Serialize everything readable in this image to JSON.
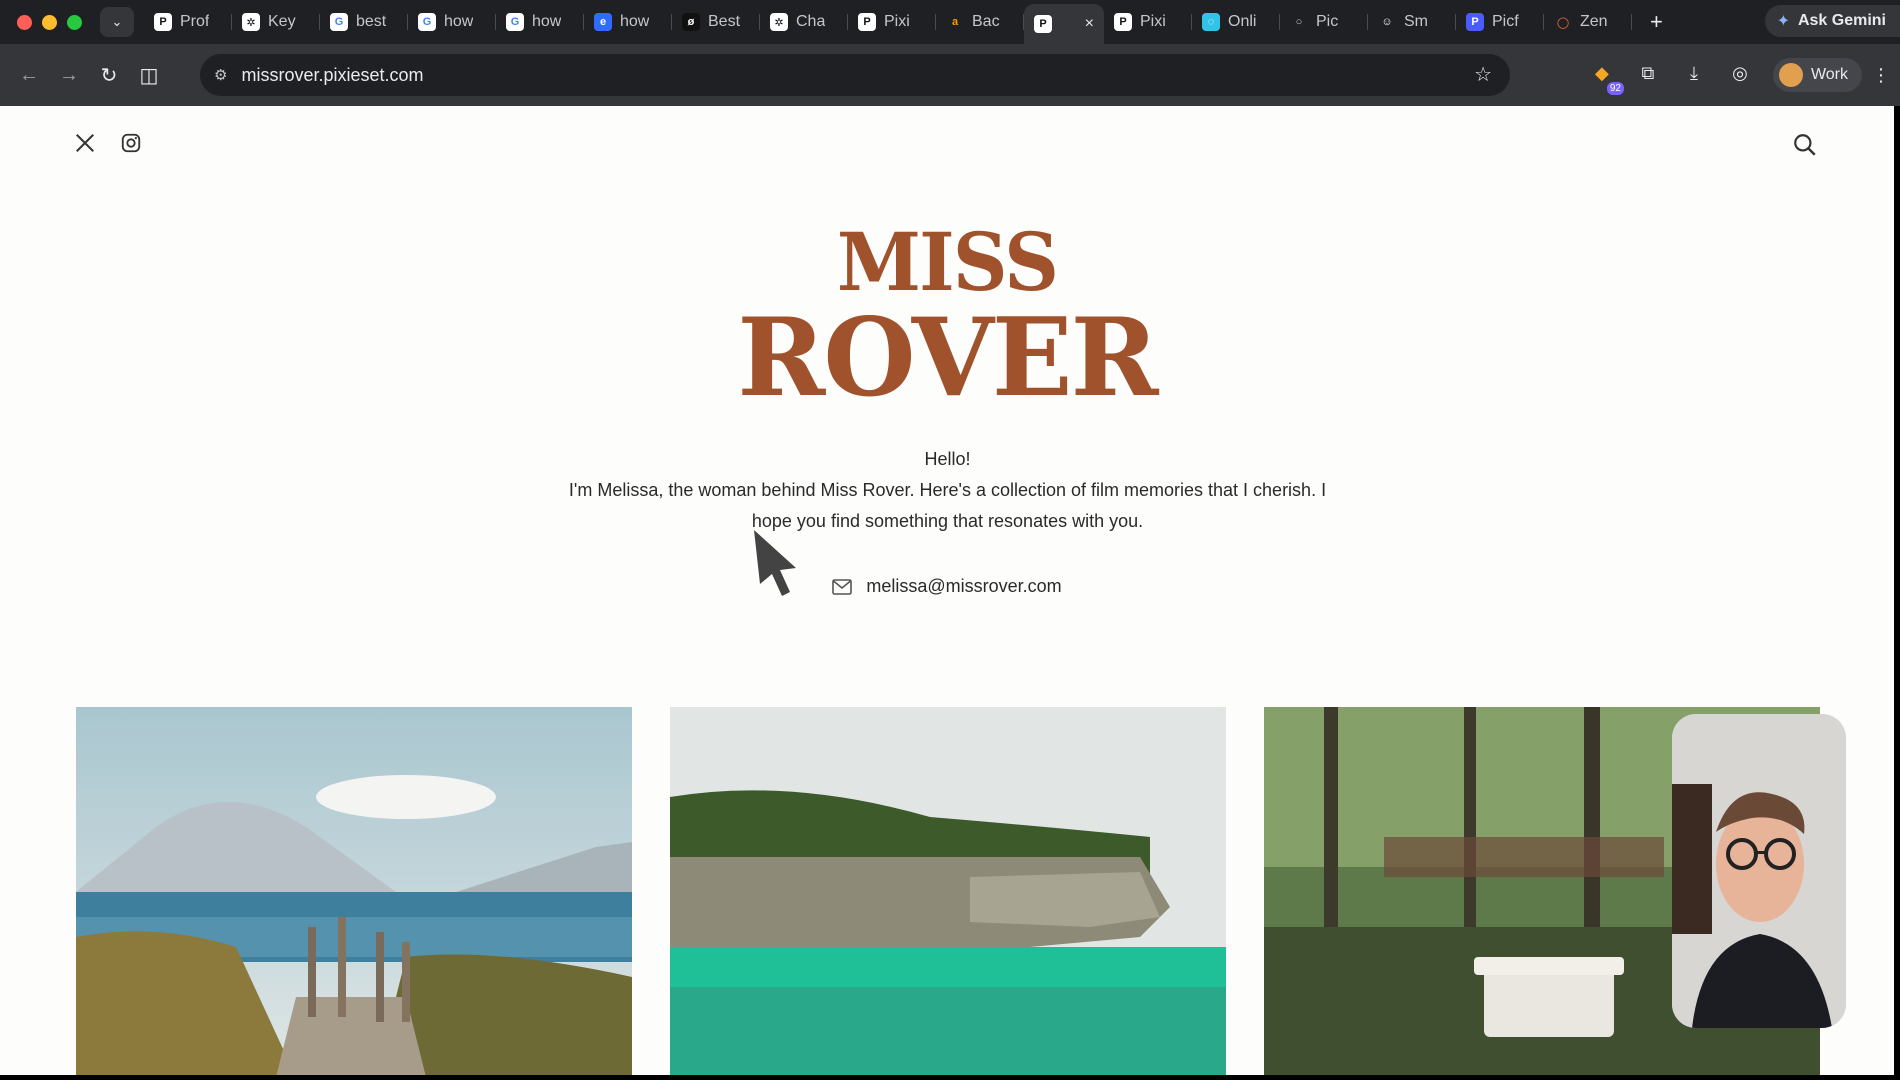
{
  "browser": {
    "tabs": [
      {
        "title": "Prof",
        "icon": "pixieset-icon"
      },
      {
        "title": "Key",
        "icon": "chatgpt-icon"
      },
      {
        "title": "best",
        "icon": "google-icon"
      },
      {
        "title": "how",
        "icon": "google-icon"
      },
      {
        "title": "how",
        "icon": "google-icon"
      },
      {
        "title": "how",
        "icon": "edge-icon"
      },
      {
        "title": "Best",
        "icon": "site-icon"
      },
      {
        "title": "Cha",
        "icon": "chatgpt-icon"
      },
      {
        "title": "Pixi",
        "icon": "pixieset-icon"
      },
      {
        "title": "Bac",
        "icon": "amazon-icon"
      },
      {
        "title": "",
        "icon": "pixieset-icon",
        "active": true
      },
      {
        "title": "Pixi",
        "icon": "pixieset-icon"
      },
      {
        "title": "Onli",
        "icon": "online-icon"
      },
      {
        "title": "Pic",
        "icon": "pic-icon"
      },
      {
        "title": "Sm",
        "icon": "smile-icon"
      },
      {
        "title": "Picf",
        "icon": "picflow-icon"
      },
      {
        "title": "Zen",
        "icon": "zen-icon"
      }
    ],
    "gemini_label": "Ask Gemini",
    "url": "missrover.pixieset.com",
    "extension_badge": "92",
    "profile_label": "Work",
    "colors": {
      "chrome_bg": "#1f2023",
      "toolbar_bg": "#35363a"
    }
  },
  "site": {
    "logo_line1": "MISS",
    "logo_line2": "ROVER",
    "greeting": "Hello!",
    "intro": "I'm Melissa, the woman behind Miss Rover. Here's a collection of film memories that I cherish. I hope you find something that resonates with you.",
    "email": "melissa@missrover.com",
    "brand_color": "#a0522d"
  }
}
